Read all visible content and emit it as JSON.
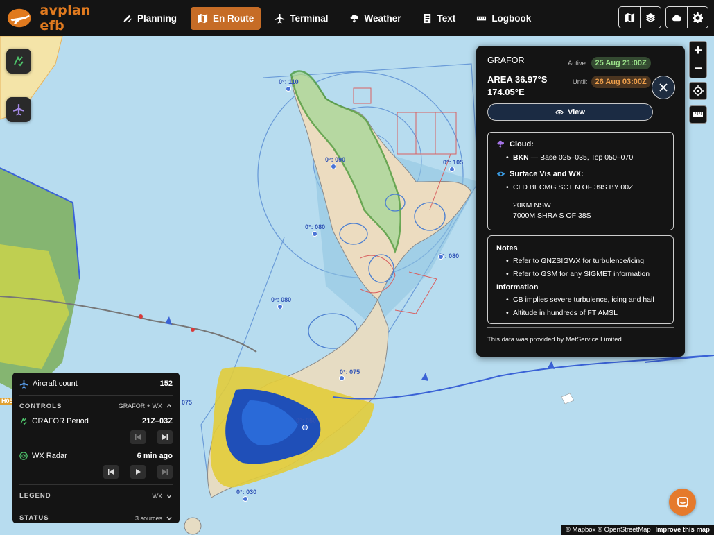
{
  "app": {
    "brand": "avplan efb"
  },
  "nav": {
    "items": [
      {
        "label": "Planning",
        "icon": "pencil-chart-icon",
        "active": false
      },
      {
        "label": "En Route",
        "icon": "map-icon",
        "active": true
      },
      {
        "label": "Terminal",
        "icon": "plane-icon",
        "active": false
      },
      {
        "label": "Weather",
        "icon": "cloud-bolt-icon",
        "active": false
      },
      {
        "label": "Text",
        "icon": "document-icon",
        "active": false
      },
      {
        "label": "Logbook",
        "icon": "ruler-book-icon",
        "active": false
      }
    ]
  },
  "map": {
    "labels": [
      {
        "text": "0°: 110"
      },
      {
        "text": "0°: 090"
      },
      {
        "text": "0°: 105"
      },
      {
        "text": "0°: 080"
      },
      {
        "text": "0°: 080"
      },
      {
        "text": "0°: 080"
      },
      {
        "text": "0°: 075"
      },
      {
        "text": "075"
      },
      {
        "text": "0°: 050"
      },
      {
        "text": "0°: 030"
      }
    ],
    "edge_label": "H05",
    "zoom_in": "+",
    "zoom_out": "−"
  },
  "grafor": {
    "title": "GRAFOR",
    "area_line1": "AREA 36.97°S",
    "area_line2": "174.05°E",
    "active_label": "Active:",
    "active_time": "25 Aug 21:00Z",
    "until_label": "Until:",
    "until_time": "26 Aug 03:00Z",
    "view_label": "View",
    "cloud_heading": "Cloud:",
    "cloud_code": "BKN",
    "cloud_desc": " — Base 025–035, Top 050–070",
    "vis_heading": "Surface Vis and WX:",
    "vis_line1": "CLD BECMG SCT N OF 39S BY 00Z",
    "vis_line2": "20KM NSW",
    "vis_line3": "7000M SHRA S OF 38S",
    "notes_heading": "Notes",
    "notes": [
      "Refer to GNZSIGWX for turbulence/icing",
      "Refer to GSM for any SIGMET information"
    ],
    "info_heading": "Information",
    "info": [
      "CB implies severe turbulence, icing and hail",
      "Altitude in hundreds of FT AMSL"
    ],
    "footer": "This data was provided by MetService Limited"
  },
  "controls": {
    "aircraft_label": "Aircraft count",
    "aircraft_count": "152",
    "controls_title": "CONTROLS",
    "controls_meta": "GRAFOR + WX",
    "grafor_label": "GRAFOR Period",
    "grafor_value": "21Z–03Z",
    "radar_label": "WX Radar",
    "radar_value": "6 min ago",
    "legend_title": "LEGEND",
    "legend_meta": "WX",
    "status_title": "STATUS",
    "status_meta": "3 sources"
  },
  "attribution": {
    "text": "© Mapbox © OpenStreetMap",
    "link": "Improve this map"
  },
  "colors": {
    "accent": "#c66c26",
    "panel": "#141414",
    "sea": "#b7dcef"
  }
}
